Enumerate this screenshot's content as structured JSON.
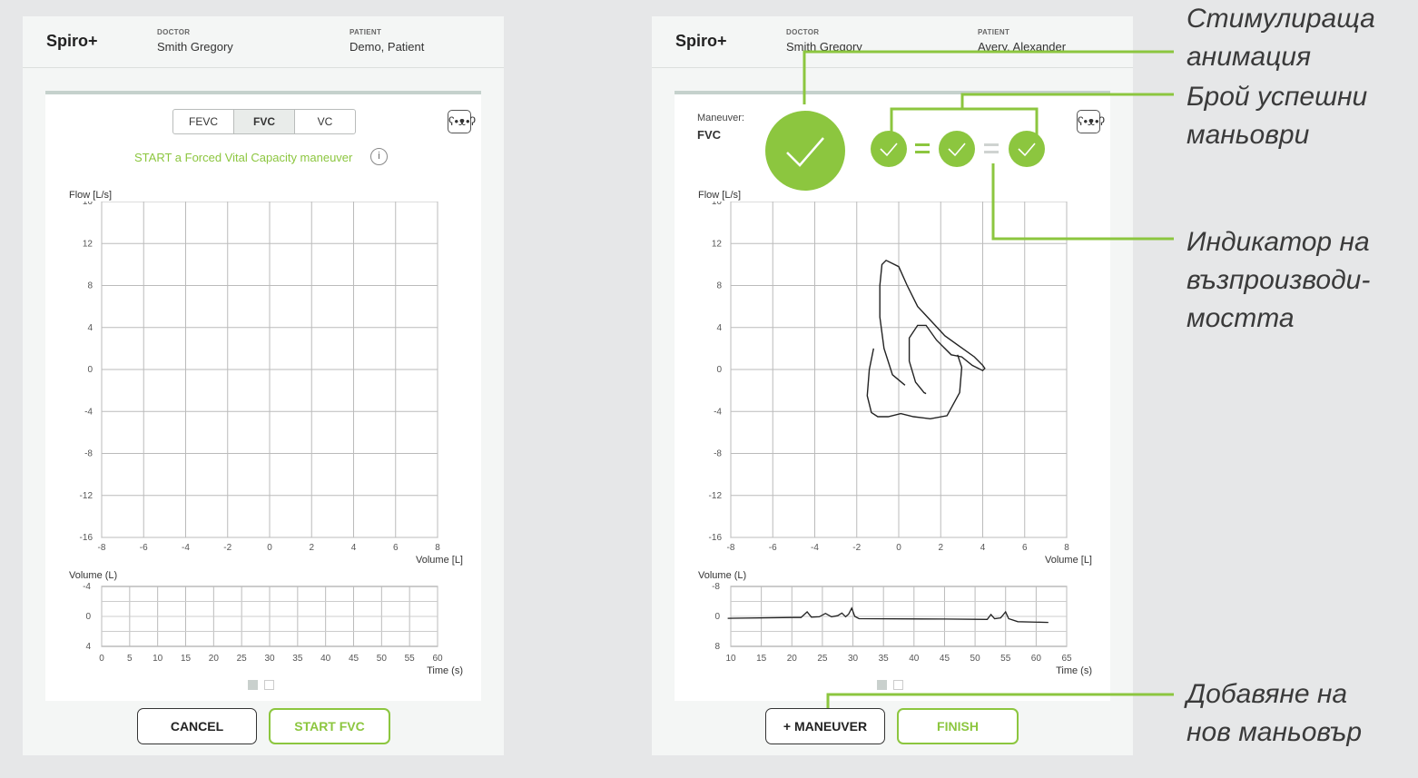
{
  "left": {
    "brand": "Spiro+",
    "doctor_label": "DOCTOR",
    "doctor_name": "Smith Gregory",
    "patient_label": "PATIENT",
    "patient_name": "Demo, Patient",
    "tabs": [
      {
        "label": "FEVC",
        "active": false
      },
      {
        "label": "FVC",
        "active": true
      },
      {
        "label": "VC",
        "active": false
      }
    ],
    "prompt": "START a Forced Vital Capacity maneuver",
    "info_icon": "i",
    "flow_label": "Flow [L/s]",
    "flow_ticks": [
      "16",
      "12",
      "8",
      "4",
      "0",
      "-4",
      "-8",
      "-12",
      "-16"
    ],
    "volume_ticks": [
      "-8",
      "-6",
      "-4",
      "-2",
      "0",
      "2",
      "4",
      "6",
      "8"
    ],
    "volume_axis_label": "Volume [L]",
    "volume_label": "Volume (L)",
    "vol_ticks": [
      "-4",
      "0",
      "4"
    ],
    "time_ticks": [
      "0",
      "5",
      "10",
      "15",
      "20",
      "25",
      "30",
      "35",
      "40",
      "45",
      "50",
      "55",
      "60"
    ],
    "time_label": "Time (s)",
    "cancel_label": "CANCEL",
    "start_label": "START FVC"
  },
  "right": {
    "brand": "Spiro+",
    "doctor_label": "DOCTOR",
    "doctor_name": "Smith Gregory",
    "patient_label": "PATIENT",
    "patient_name": "Avery, Alexander",
    "maneuver_label": "Maneuver:",
    "maneuver_value": "FVC",
    "flow_label": "Flow [L/s]",
    "flow_ticks": [
      "16",
      "12",
      "8",
      "4",
      "0",
      "-4",
      "-8",
      "-12",
      "-16"
    ],
    "volume_ticks": [
      "-8",
      "-6",
      "-4",
      "-2",
      "0",
      "2",
      "4",
      "6",
      "8"
    ],
    "volume_axis_label": "Volume [L]",
    "volume_label": "Volume (L)",
    "vol_ticks": [
      "-8",
      "0",
      "8"
    ],
    "time_ticks": [
      "10",
      "15",
      "20",
      "25",
      "30",
      "35",
      "40",
      "45",
      "50",
      "55",
      "60",
      "65"
    ],
    "time_label": "Time (s)",
    "add_label": "+ MANEUVER",
    "finish_label": "FINISH"
  },
  "callouts": {
    "animation": [
      "Стимулираща",
      "анимация"
    ],
    "successful": [
      "Брой успешни",
      "маньоври"
    ],
    "reproducibility": [
      "Индикатор на",
      "възпроизводи-",
      "мостта"
    ],
    "add_new": [
      "Добавяне на",
      "нов маньовър"
    ]
  },
  "colors": {
    "accent": "#8cc63f",
    "background": "#e6e7e8",
    "panel": "#f4f6f5"
  },
  "icons": {
    "bear": "bear-icon",
    "check": "check-icon",
    "info": "info-icon"
  }
}
